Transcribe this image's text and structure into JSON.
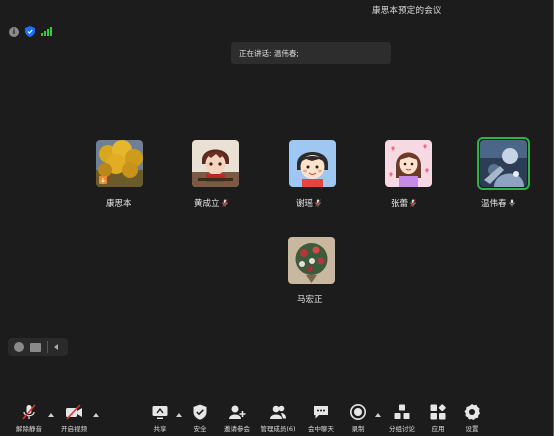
{
  "window": {
    "title": "康思本预定的会议"
  },
  "banner": {
    "speaking_text": "正在讲话: 温伟春;"
  },
  "participants": [
    {
      "name": "康思本",
      "avatar_icon": "yellow-flowers-photo",
      "muted": false
    },
    {
      "name": "黄成立",
      "avatar_icon": "anime-boy-avatar",
      "muted": true
    },
    {
      "name": "谢瑶",
      "avatar_icon": "cartoon-girl-avatar",
      "muted": true
    },
    {
      "name": "张蕾",
      "avatar_icon": "cartoon-girl-hearts-avatar",
      "muted": true
    },
    {
      "name": "温伟春",
      "avatar_icon": "blue-photo-avatar",
      "muted": false,
      "speaking": true
    },
    {
      "name": "马宏正",
      "avatar_icon": "flower-bouquet-photo",
      "muted": false
    }
  ],
  "toolbar": {
    "unmute": "解除静音",
    "start_video": "开启视频",
    "share": "共享",
    "security": "安全",
    "invite": "邀请参会",
    "members": "管理成员(6)",
    "chat": "会中聊天",
    "record": "录制",
    "breakout": "分组讨论",
    "apps": "应用",
    "settings": "设置"
  },
  "colors": {
    "background": "#1c1c1c",
    "active_speaker": "#2bb24c",
    "signal": "#2ecc40",
    "security": "#1e6fff"
  }
}
